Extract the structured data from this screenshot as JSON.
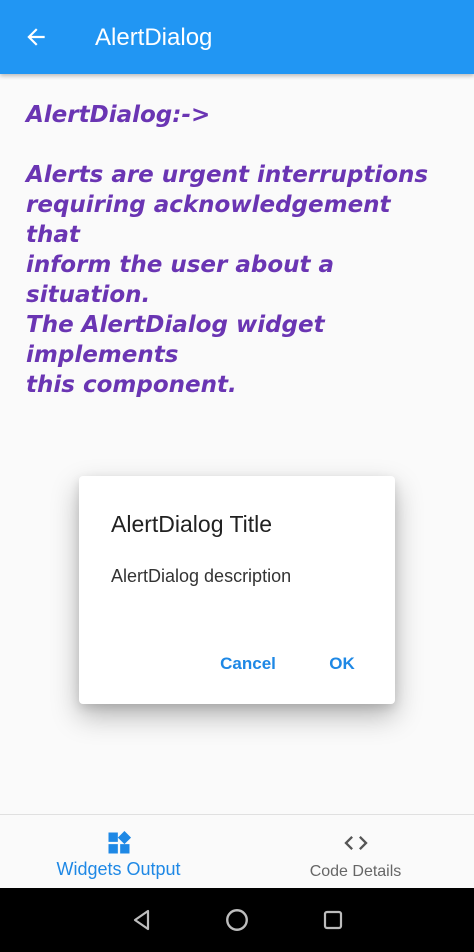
{
  "appbar": {
    "title": "AlertDialog",
    "back_icon": "arrow-back-icon",
    "color": "#2196f3"
  },
  "content": {
    "heading": "AlertDialog:->",
    "lines": [
      "Alerts are urgent interruptions",
      "requiring acknowledgement that",
      "inform the user about a situation.",
      "The AlertDialog widget implements",
      "this component."
    ],
    "text_color": "#6a35b3"
  },
  "dialog": {
    "title": "AlertDialog Title",
    "description": "AlertDialog description",
    "cancel_label": "Cancel",
    "ok_label": "OK",
    "accent": "#1e88e5"
  },
  "bottom_nav": {
    "items": [
      {
        "label": "Widgets Output",
        "icon": "widgets-icon",
        "selected": true
      },
      {
        "label": "Code Details",
        "icon": "code-icon",
        "selected": false
      }
    ]
  },
  "system_nav": {
    "icons": [
      "back-triangle-icon",
      "home-circle-icon",
      "recents-square-icon"
    ]
  }
}
